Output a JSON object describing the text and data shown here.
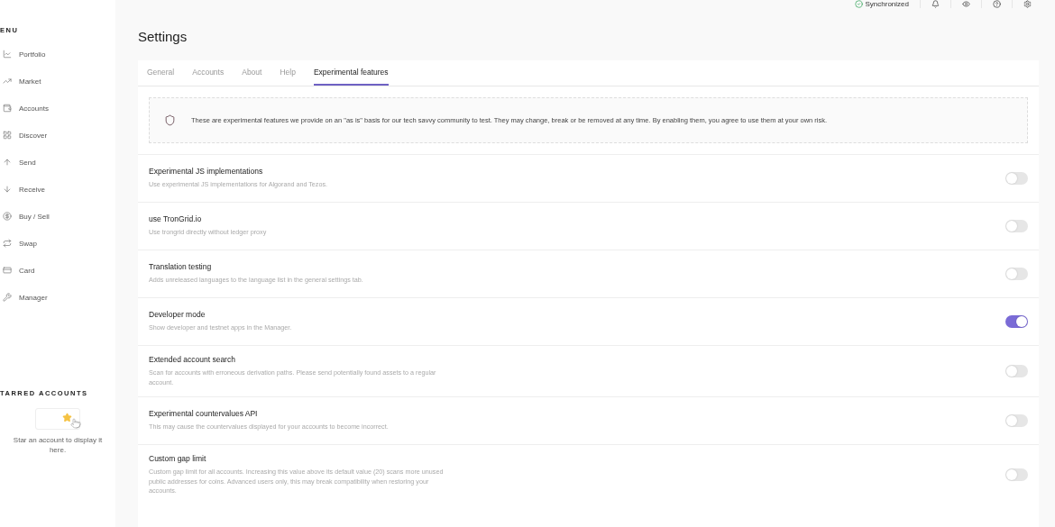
{
  "sidebar": {
    "menu_heading": "ENU",
    "items": [
      {
        "label": "Portfolio"
      },
      {
        "label": "Market"
      },
      {
        "label": "Accounts"
      },
      {
        "label": "Discover"
      },
      {
        "label": "Send"
      },
      {
        "label": "Receive"
      },
      {
        "label": "Buy / Sell"
      },
      {
        "label": "Swap"
      },
      {
        "label": "Card"
      },
      {
        "label": "Manager"
      }
    ],
    "starred_heading": "TARRED ACCOUNTS",
    "starred_empty": "Star an account to display it here."
  },
  "top_bar": {
    "sync_status": "Synchronized"
  },
  "page_title": "Settings",
  "tabs": [
    {
      "label": "General",
      "selected": false
    },
    {
      "label": "Accounts",
      "selected": false
    },
    {
      "label": "About",
      "selected": false
    },
    {
      "label": "Help",
      "selected": false
    },
    {
      "label": "Experimental features",
      "selected": true
    }
  ],
  "notice": "These are experimental features we provide on an \"as is\" basis for our tech savvy community to test. They may change, break or be removed at any time. By enabling them, you agree to use them at your own risk.",
  "features": [
    {
      "title": "Experimental JS implementations",
      "description": "Use experimental JS implementations for Algorand and Tezos.",
      "on": false
    },
    {
      "title": "use TronGrid.io",
      "description": "Use trongrid directly without ledger proxy",
      "on": false
    },
    {
      "title": "Translation testing",
      "description": "Adds unreleased languages to the language list in the general settings tab.",
      "on": false
    },
    {
      "title": "Developer mode",
      "description": "Show developer and testnet apps in the Manager.",
      "on": true
    },
    {
      "title": "Extended account search",
      "description": "Scan for accounts with erroneous derivation paths. Please send potentially found assets to a regular account.",
      "on": false
    },
    {
      "title": "Experimental countervalues API",
      "description": "This may cause the countervalues displayed for your accounts to become incorrect.",
      "on": false
    },
    {
      "title": "Custom gap limit",
      "description": "Custom gap limit for all accounts. Increasing this value above its default value (20) scans more unused public addresses for coins. Advanced users only, this may break compatibility when restoring your accounts.",
      "on": false
    }
  ]
}
